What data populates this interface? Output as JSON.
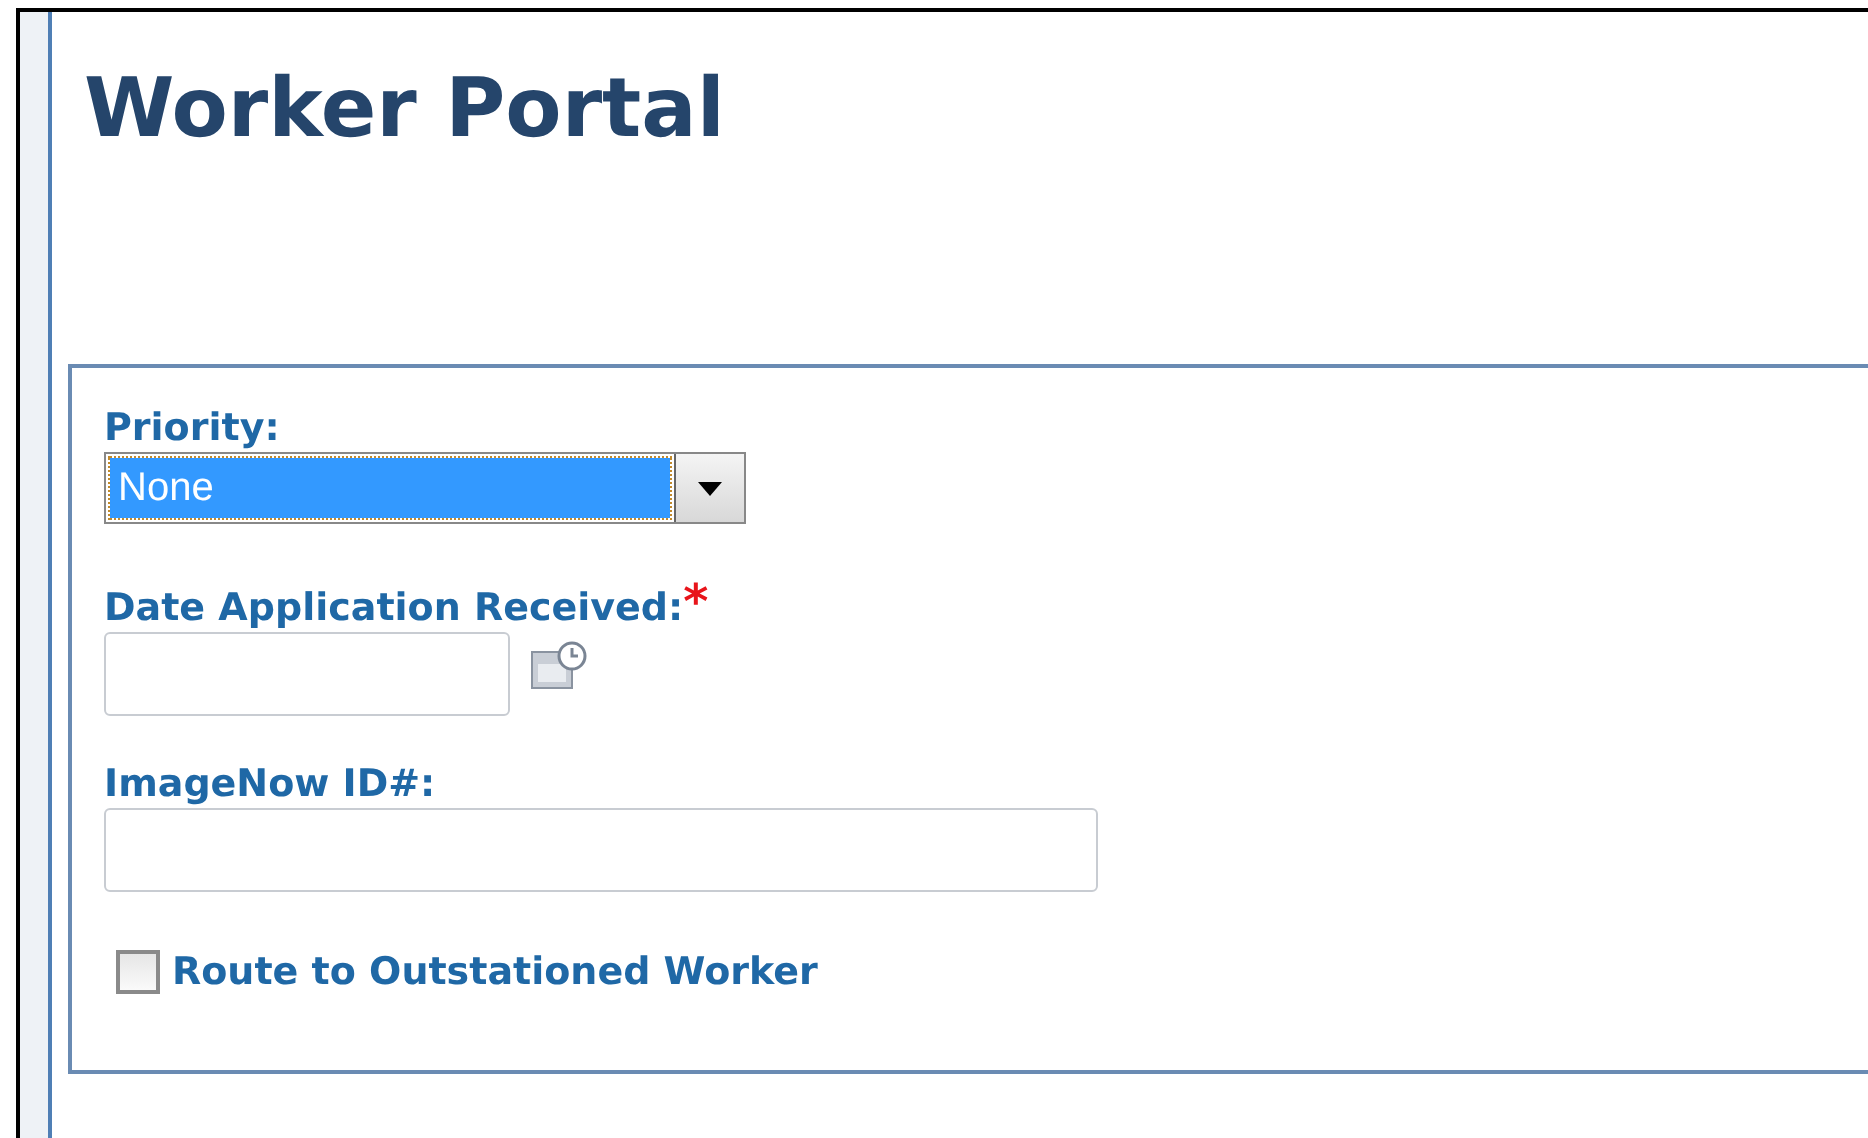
{
  "page": {
    "title": "Worker Portal"
  },
  "form": {
    "fields": [
      {
        "kind": "select",
        "label": "Priority:",
        "value": "None",
        "highlighted": true
      },
      {
        "kind": "date",
        "label": "Date Application Received:",
        "required_mark": "*"
      },
      {
        "kind": "text",
        "label": "ImageNow ID#:"
      },
      {
        "kind": "checkbox",
        "label": "Route to Outstationed Worker",
        "checked": false
      }
    ]
  }
}
